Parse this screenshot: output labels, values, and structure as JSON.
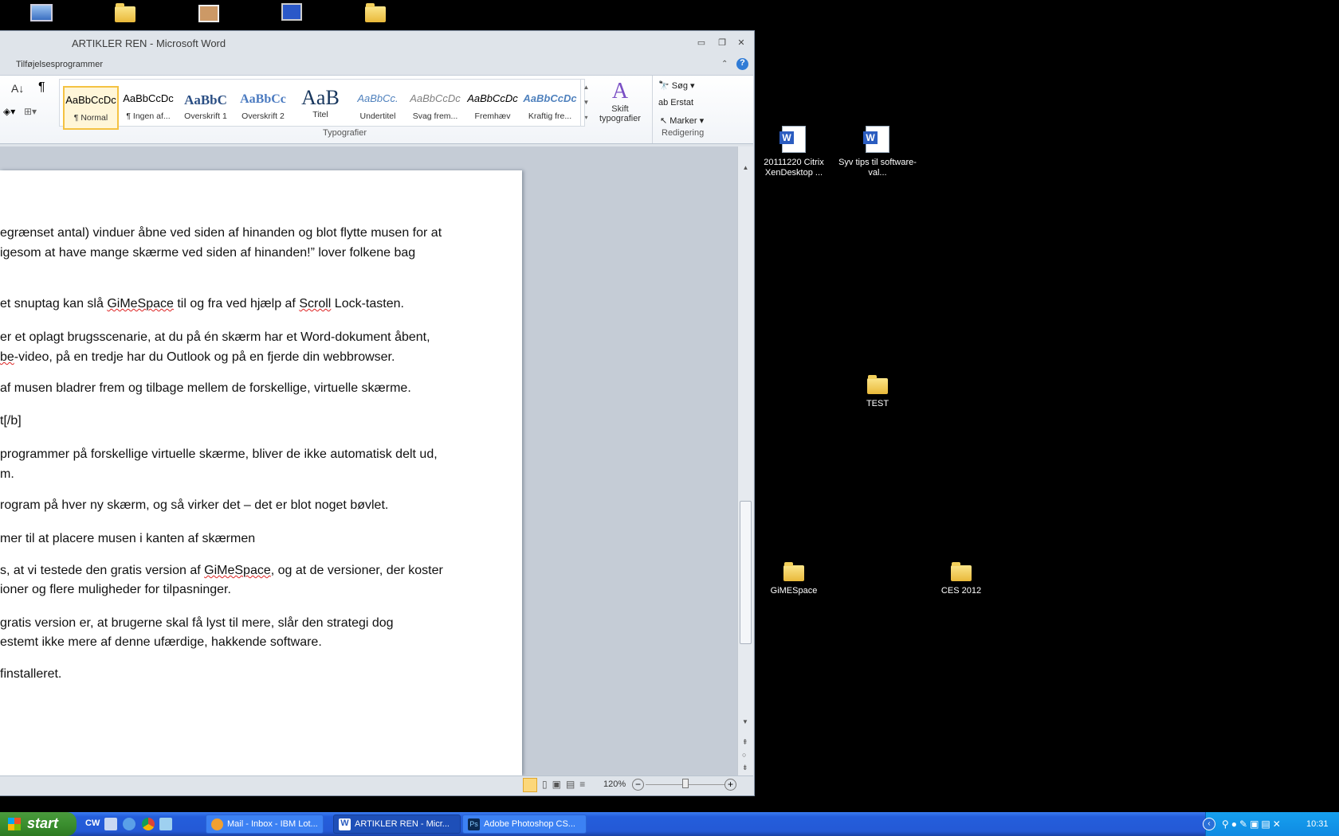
{
  "window": {
    "title": "ARTIKLER REN  -  Microsoft Word",
    "tab": "Tilføjelsesprogrammer"
  },
  "ribbon": {
    "styles": [
      {
        "preview": "AaBbCcDc",
        "name": "¶ Normal",
        "color": "#000"
      },
      {
        "preview": "AaBbCcDc",
        "name": "¶ Ingen af...",
        "color": "#000"
      },
      {
        "preview": "AaBbC",
        "name": "Overskrift 1",
        "color": "#2b4f84"
      },
      {
        "preview": "AaBbCc",
        "name": "Overskrift 2",
        "color": "#4a7ac0"
      },
      {
        "preview": "AaB",
        "name": "Titel",
        "color": "#17365d"
      },
      {
        "preview": "AaBbCc.",
        "name": "Undertitel",
        "color": "#4f81bd"
      },
      {
        "preview": "AaBbCcDc",
        "name": "Svag frem...",
        "color": "#808080"
      },
      {
        "preview": "AaBbCcDc",
        "name": "Fremhæv",
        "color": "#000"
      },
      {
        "preview": "AaBbCcDc",
        "name": "Kraftig fre...",
        "color": "#4f81bd"
      }
    ],
    "change_styles": "Skift typografier",
    "group_styles": "Typografier",
    "search": "Søg",
    "replace": "Erstat",
    "select": "Marker",
    "group_edit": "Redigering"
  },
  "document": {
    "lines": [
      [
        "egrænset antal) vinduer åbne ved siden af hinanden og blot flytte musen for at"
      ],
      [
        "igesom at have mange skærme ved siden af hinanden!”  lover folkene bag"
      ],
      [
        " et snuptag kan slå ",
        "GiMeSpace",
        " til og fra ved hjælp af ",
        "Scroll",
        " Lock-tasten."
      ],
      [
        "er et oplagt brugsscenarie, at du på én skærm har et Word-dokument åbent,"
      ],
      [
        "",
        "be",
        "-video, på en tredje har du Outlook og på en fjerde din webbrowser."
      ],
      [
        "af musen bladrer frem og tilbage mellem de forskellige, virtuelle skærme."
      ],
      [
        "t[/b]"
      ],
      [
        "programmer på forskellige virtuelle skærme, bliver de ikke automatisk delt ud,"
      ],
      [
        "m."
      ],
      [
        "rogram på hver ny skærm, og så virker det – det er blot noget bøvlet."
      ],
      [
        "mer til at placere musen i kanten af skærmen"
      ],
      [
        "s, at vi testede den gratis version af ",
        "GiMeSpace",
        ", og at de versioner, der koster"
      ],
      [
        "ioner og flere muligheder for tilpasninger."
      ],
      [
        " gratis version er, at brugerne skal få lyst til mere, slår den strategi dog"
      ],
      [
        "estemt ikke mere af denne ufærdige, hakkende software."
      ],
      [
        "finstalleret."
      ]
    ]
  },
  "status": {
    "zoom": "120%",
    "zoom_fraction": 0.5
  },
  "desktop": [
    {
      "label": "20111220 Citrix XenDesktop ...",
      "type": "word"
    },
    {
      "label": "Syv tips til software-val...",
      "type": "word"
    },
    {
      "label": "TEST",
      "type": "folder"
    },
    {
      "label": "GiMESpace",
      "type": "folder"
    },
    {
      "label": "CES 2012",
      "type": "folder"
    }
  ],
  "taskbar": {
    "start": "start",
    "quicklaunch": "CW",
    "tasks": [
      {
        "label": "Mail - Inbox - IBM Lot...",
        "icon": "lotus-notes-icon"
      },
      {
        "label": "ARTIKLER REN - Micr...",
        "icon": "word-icon"
      },
      {
        "label": "Adobe Photoshop CS...",
        "icon": "photoshop-icon"
      }
    ],
    "clock": "10:31"
  }
}
